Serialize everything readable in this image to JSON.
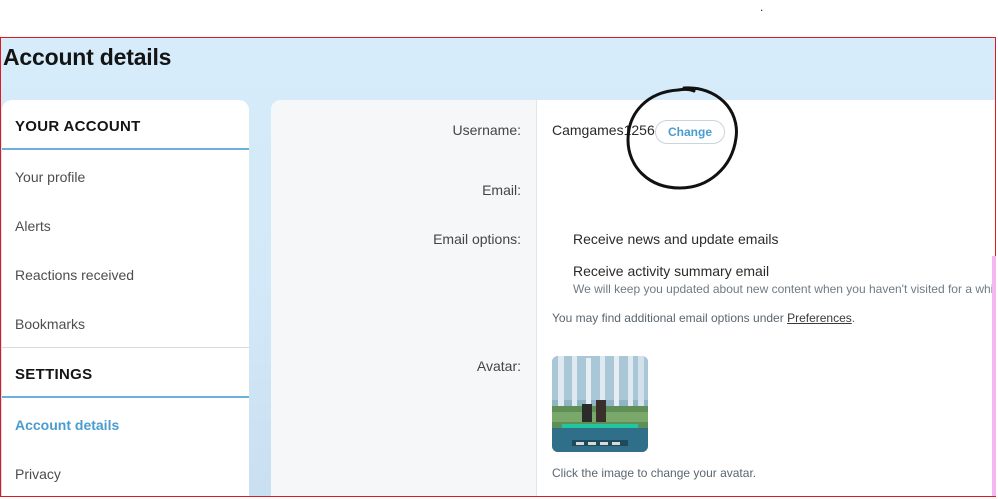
{
  "top_mark": ".",
  "page_title": "Account details",
  "sidebar": {
    "sections": [
      {
        "header": "YOUR ACCOUNT",
        "items": [
          {
            "label": "Your profile"
          },
          {
            "label": "Alerts"
          },
          {
            "label": "Reactions received"
          },
          {
            "label": "Bookmarks"
          }
        ]
      },
      {
        "header": "SETTINGS",
        "items": [
          {
            "label": "Account details",
            "active": true
          },
          {
            "label": "Privacy"
          }
        ]
      }
    ]
  },
  "form": {
    "username_label": "Username:",
    "username_value": "Camgames1256",
    "change_button": "Change",
    "email_label": "Email:",
    "email_value": "",
    "email_options_label": "Email options:",
    "options": [
      {
        "label": "Receive news and update emails"
      },
      {
        "label": "Receive activity summary email",
        "hint": "We will keep you updated about new content when you haven't visited for a whi"
      }
    ],
    "preferences_note": "You may find additional email options under",
    "preferences_link": "Preferences",
    "preferences_end": ".",
    "avatar_label": "Avatar:",
    "avatar_hint": "Click the image to change your avatar."
  },
  "colors": {
    "accent": "#4a9bd0",
    "background": "#d6ecfa",
    "frame_border": "#e0191e",
    "annotation": "#111111"
  },
  "icons": [
    "avatar-image",
    "annotation-circle"
  ]
}
